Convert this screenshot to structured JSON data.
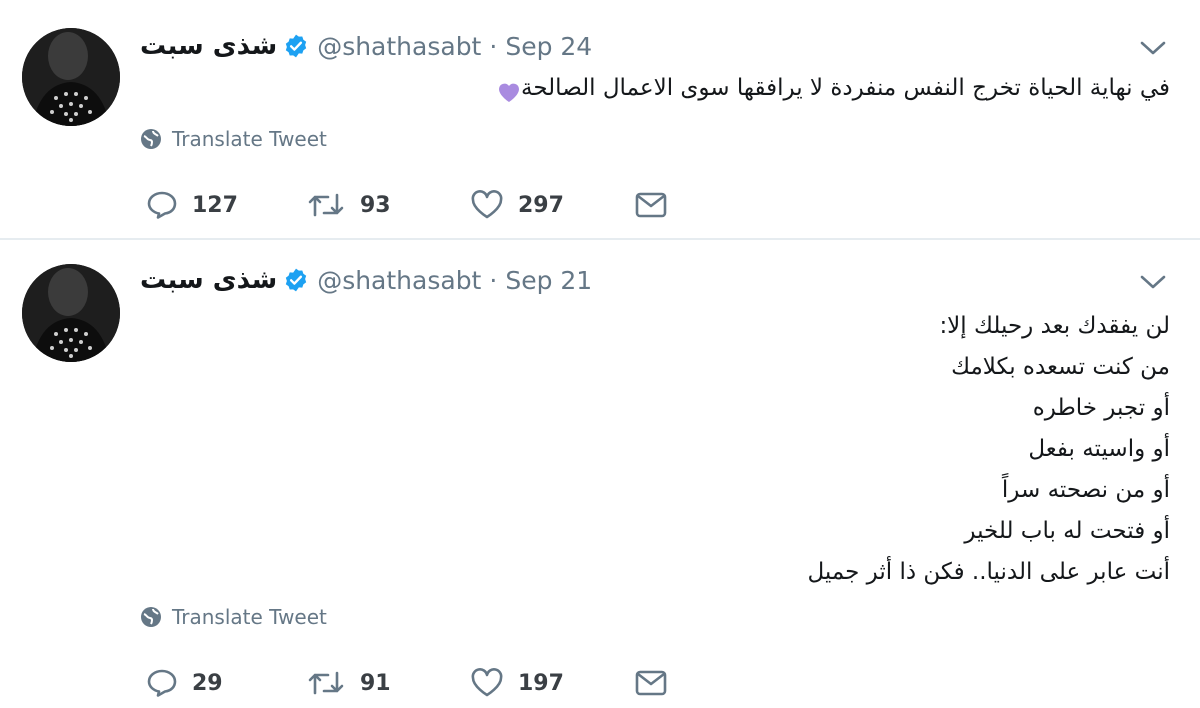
{
  "tweets": [
    {
      "name": "شذى سبت",
      "handle": "@shathasabt",
      "separator": "·",
      "date": "Sep 24",
      "text": "في نهاية الحياة تخرج النفس منفردة لا يرافقها سوى الاعمال الصالحة",
      "emoji": "purple-heart",
      "translate_label": "Translate Tweet",
      "replies": "127",
      "retweets": "93",
      "likes": "297"
    },
    {
      "name": "شذى سبت",
      "handle": "@shathasabt",
      "separator": "·",
      "date": "Sep 21",
      "lines": [
        "لن يفقدك بعد رحيلك إلا:",
        "من كنت تسعده بكلامك",
        "أو تجبر خاطره",
        "أو واسيته بفعل",
        "أو من نصحته سراً",
        "أو فتحت له باب للخير",
        "أنت عابر على الدنيا.. فكن ذا أثر جميل"
      ],
      "translate_label": "Translate Tweet",
      "replies": "29",
      "retweets": "91",
      "likes": "197"
    }
  ],
  "colors": {
    "verified": "#1da1f2",
    "muted": "#657786",
    "divider": "#e6ecf0",
    "purple_heart": "#a98be0"
  }
}
